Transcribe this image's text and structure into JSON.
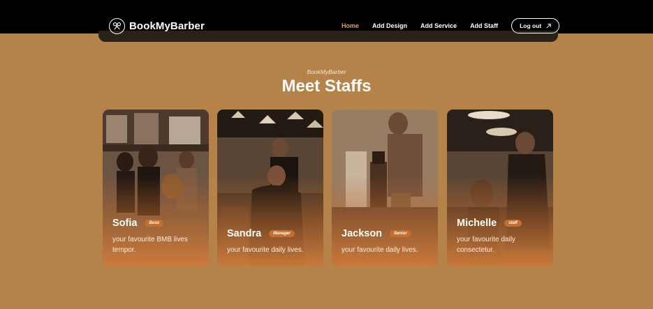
{
  "brand": {
    "name": "BookMyBarber",
    "logo_icon": "scissors-comb-icon"
  },
  "nav": {
    "items": [
      {
        "label": "Home",
        "active": true
      },
      {
        "label": "Add Design",
        "active": false
      },
      {
        "label": "Add Service",
        "active": false
      },
      {
        "label": "Add Staff",
        "active": false
      }
    ],
    "logout_label": "Log out",
    "logout_icon": "arrow-up-right-icon"
  },
  "section": {
    "eyebrow": "BookMyBarber",
    "title": "Meet Staffs"
  },
  "staff": [
    {
      "name": "Sofia",
      "role": "Boss",
      "description": "your favourite BMB lives tempor."
    },
    {
      "name": "Sandra",
      "role": "Manager",
      "description": "your favourite daily lives."
    },
    {
      "name": "Jackson",
      "role": "Senior",
      "description": "your favourite daily lives."
    },
    {
      "name": "Michelle",
      "role": "staff",
      "description": "your favourite daily consectetur."
    }
  ],
  "colors": {
    "page_background": "#b5824a",
    "nav_background": "#000000",
    "active_link": "#e0a25a",
    "badge": "#c46f2d"
  }
}
